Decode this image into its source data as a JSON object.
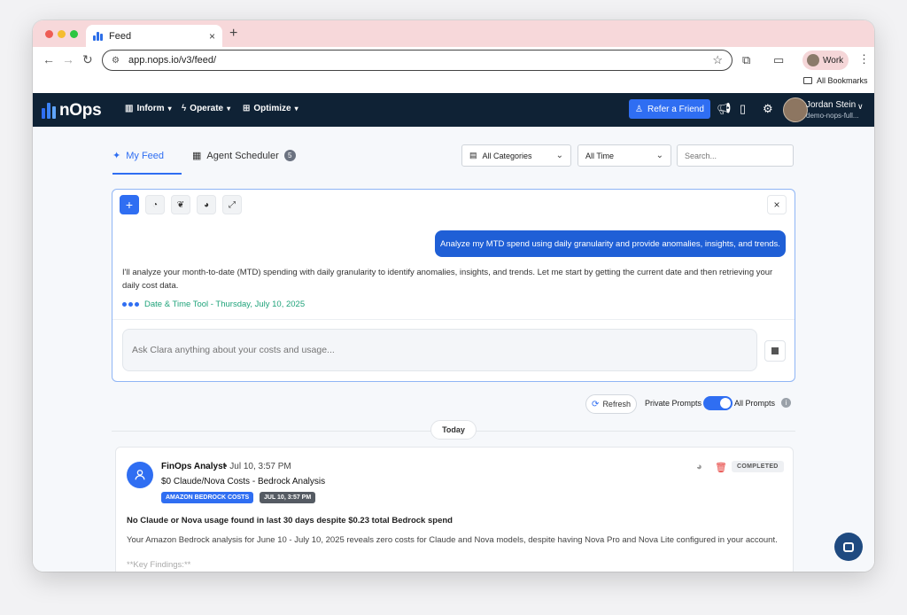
{
  "browser": {
    "tab_title": "Feed",
    "tab_close": "×",
    "new_tab": "+",
    "url": "app.nops.io/v3/feed/",
    "profile_label": "Work",
    "bookmarks_label": "All Bookmarks",
    "colors": {
      "close": "#ee5d55",
      "minimize": "#f5bd2f",
      "maximize": "#2dc641"
    }
  },
  "nav": {
    "logo_text": "nOps",
    "menus": [
      {
        "label": "Inform",
        "icon": "bar-chart-icon"
      },
      {
        "label": "Operate",
        "icon": "bolt-icon"
      },
      {
        "label": "Optimize",
        "icon": "sliders-icon"
      }
    ],
    "refer_label": "Refer a Friend",
    "user_name": "Jordan Stein",
    "user_org": "demo-nops-full..."
  },
  "feed": {
    "tabs": [
      {
        "label": "My Feed",
        "active": true
      },
      {
        "label": "Agent Scheduler",
        "badge": "5",
        "active": false
      }
    ],
    "category_filter": "All Categories",
    "time_filter": "All Time",
    "search_placeholder": "Search..."
  },
  "chat": {
    "close": "×",
    "add": "+",
    "user_message": "Analyze my MTD spend using daily granularity and provide anomalies, insights, and trends.",
    "assistant_reply": "I'll analyze your month-to-date (MTD) spending with daily granularity to identify anomalies, insights, and trends. Let me start by getting the current date and then retrieving your daily cost data.",
    "tool_status": "Date & Time Tool - Thursday, July 10, 2025",
    "input_placeholder": "Ask Clara anything about your costs and usage..."
  },
  "controls": {
    "refresh_label": "Refresh",
    "private_label": "Private Prompts",
    "all_label": "All Prompts",
    "toggle_on": true,
    "day_label": "Today",
    "info": "i"
  },
  "card": {
    "author": "FinOps Analyst",
    "time": "Jul 10, 3:57 PM",
    "title": "$0 Claude/Nova Costs - Bedrock Analysis",
    "tags": [
      {
        "label": "AMAZON BEDROCK COSTS",
        "color": "#2f6ef2"
      },
      {
        "label": "JUL 10, 3:57 PM",
        "color": "#555b63"
      }
    ],
    "status": "COMPLETED",
    "headline": "No Claude or Nova usage found in last 30 days despite $0.23 total Bedrock spend",
    "body": "Your Amazon Bedrock analysis for June 10 - July 10, 2025 reveals zero costs for Claude and Nova models, despite having Nova Pro and Nova Lite configured in your account.",
    "faded": "**Key Findings:**"
  }
}
